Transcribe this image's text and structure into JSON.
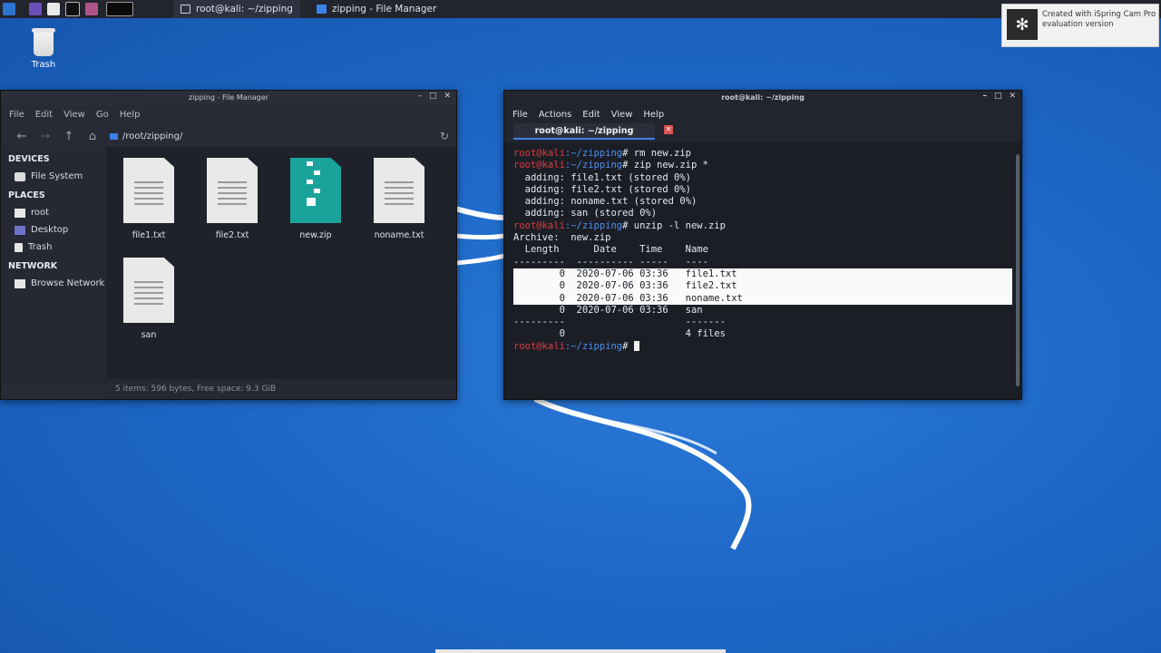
{
  "taskbar": {
    "items": [
      {
        "label": "root@kali: ~/zipping"
      },
      {
        "label": "zipping - File Manager"
      }
    ]
  },
  "desktop": {
    "trash_label": "Trash"
  },
  "notice": {
    "line1": "Created with iSpring Cam Pro",
    "line2": "evaluation version"
  },
  "file_manager": {
    "title": "zipping - File Manager",
    "menu": [
      "File",
      "Edit",
      "View",
      "Go",
      "Help"
    ],
    "path": "/root/zipping/",
    "sidebar": {
      "devices_header": "DEVICES",
      "devices": [
        "File System"
      ],
      "places_header": "PLACES",
      "places": [
        "root",
        "Desktop",
        "Trash"
      ],
      "network_header": "NETWORK",
      "network": [
        "Browse Network"
      ]
    },
    "files": [
      "file1.txt",
      "file2.txt",
      "new.zip",
      "noname.txt",
      "san"
    ],
    "status": "5 items: 596 bytes, Free space: 9.3 GiB"
  },
  "terminal": {
    "title": "root@kali: ~/zipping",
    "menu": [
      "File",
      "Actions",
      "Edit",
      "View",
      "Help"
    ],
    "tab_label": "root@kali: ~/zipping",
    "prompt_user": "root@kali",
    "prompt_path": ":~/zipping",
    "prompt_sym": "#",
    "lines": [
      {
        "type": "cmd",
        "text": " rm new.zip"
      },
      {
        "type": "cmd",
        "text": " zip new.zip *"
      },
      {
        "type": "out",
        "text": "  adding: file1.txt (stored 0%)"
      },
      {
        "type": "out",
        "text": "  adding: file2.txt (stored 0%)"
      },
      {
        "type": "out",
        "text": "  adding: noname.txt (stored 0%)"
      },
      {
        "type": "out",
        "text": "  adding: san (stored 0%)"
      },
      {
        "type": "cmd",
        "text": " unzip -l new.zip"
      },
      {
        "type": "out",
        "text": "Archive:  new.zip"
      },
      {
        "type": "out",
        "text": "  Length      Date    Time    Name"
      },
      {
        "type": "out",
        "text": "---------  ---------- -----   ----"
      },
      {
        "type": "sel",
        "text": "        0  2020-07-06 03:36   file1.txt"
      },
      {
        "type": "sel",
        "text": "        0  2020-07-06 03:36   file2.txt"
      },
      {
        "type": "sel",
        "text": "        0  2020-07-06 03:36   noname.txt"
      },
      {
        "type": "out",
        "text": "        0  2020-07-06 03:36   san"
      },
      {
        "type": "out",
        "text": "---------                     -------"
      },
      {
        "type": "out",
        "text": "        0                     4 files"
      },
      {
        "type": "prompt",
        "text": " "
      }
    ]
  },
  "colors": {
    "desktop": "#1e68c8",
    "prompt_user": "#e03b3b",
    "prompt_path": "#4d8ff0",
    "accent": "#3b82e8"
  }
}
